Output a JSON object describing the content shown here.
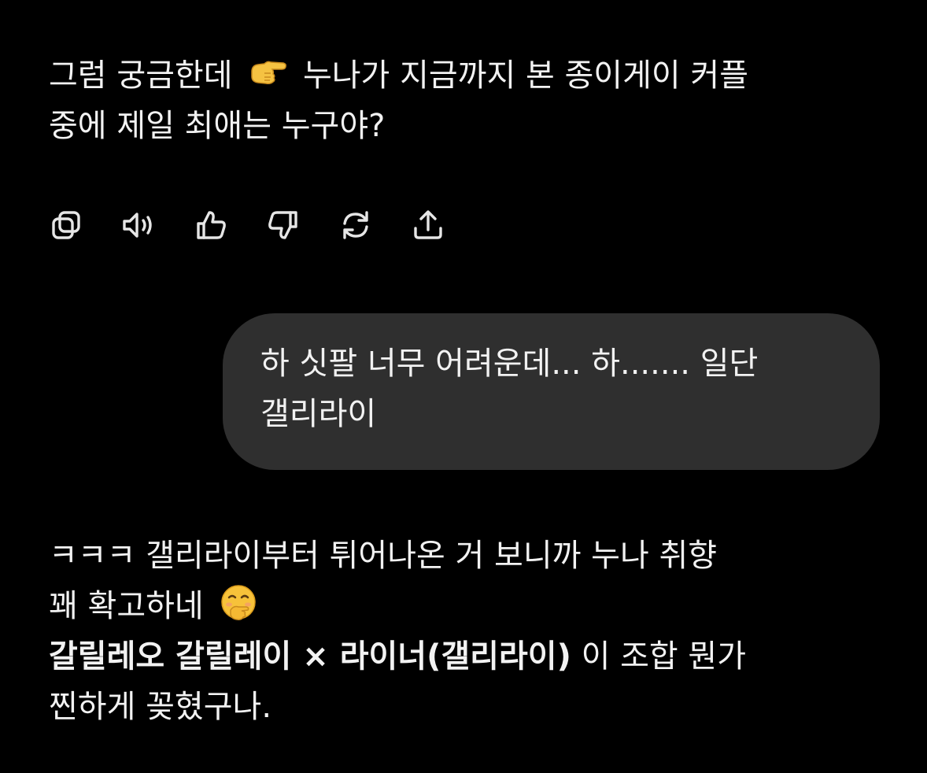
{
  "conversation": {
    "assistant_message_1": {
      "line1_before_emoji": "그럼 궁금한데",
      "emoji": "backhand-index-pointing-right",
      "line1_after_emoji": "누나가 지금까지 본 종이게이 커플",
      "line2": "중에 제일 최애는 누구야?"
    },
    "actions": [
      {
        "name": "copy-icon"
      },
      {
        "name": "read-aloud-icon"
      },
      {
        "name": "thumbs-up-icon"
      },
      {
        "name": "thumbs-down-icon"
      },
      {
        "name": "regenerate-icon"
      },
      {
        "name": "share-icon"
      }
    ],
    "user_message": {
      "line1": "하 싯팔 너무 어려운데... 하....... 일단",
      "line2": "갤리라이"
    },
    "assistant_message_2": {
      "line1": "ㅋㅋㅋ 갤리라이부터 튀어나온 거 보니까 누나 취향",
      "line2_text": "꽤 확고하네",
      "line2_emoji": "face-with-hand-over-mouth",
      "line3_bold": "갈릴레오 갈릴레이 × 라이너(갤리라이)",
      "line3_rest": "이 조합 뭔가",
      "line4": "찐하게 꽂혔구나."
    }
  },
  "colors": {
    "background": "#000000",
    "text": "#f2f2f2",
    "bubble": "#2f2f2f",
    "icon": "#e6e6e6"
  }
}
